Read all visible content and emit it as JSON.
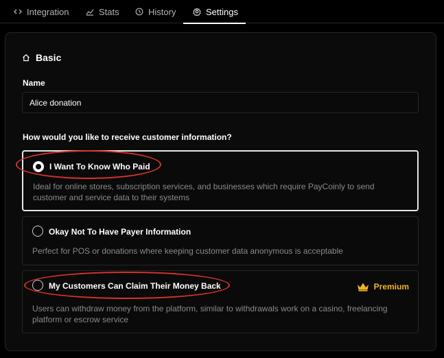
{
  "tabs": [
    {
      "label": "Integration",
      "icon": "code-icon"
    },
    {
      "label": "Stats",
      "icon": "chart-line-icon"
    },
    {
      "label": "History",
      "icon": "history-icon"
    },
    {
      "label": "Settings",
      "icon": "gear-icon",
      "active": true
    }
  ],
  "settings": {
    "section_title": "Basic",
    "name_label": "Name",
    "name_value": "Alice donation",
    "question": "How would you like to receive customer information?",
    "options": [
      {
        "title": "I Want To Know Who Paid",
        "description": "Ideal for online stores, subscription services, and businesses which require PayCoinly to send customer and service data to their systems",
        "selected": true
      },
      {
        "title": "Okay Not To Have Payer Information",
        "description": "Perfect for POS or donations where keeping customer data anonymous is acceptable",
        "selected": false
      },
      {
        "title": "My Customers Can Claim Their Money Back",
        "description": "Users can withdraw money from the platform, similar to withdrawals work on a casino, freelancing platform or escrow service",
        "selected": false,
        "badge": "Premium"
      }
    ]
  },
  "colors": {
    "background": "#000000",
    "panel": "#0b0b0b",
    "border": "#262626",
    "premium": "#f0b429",
    "annotation": "#d9322b"
  }
}
